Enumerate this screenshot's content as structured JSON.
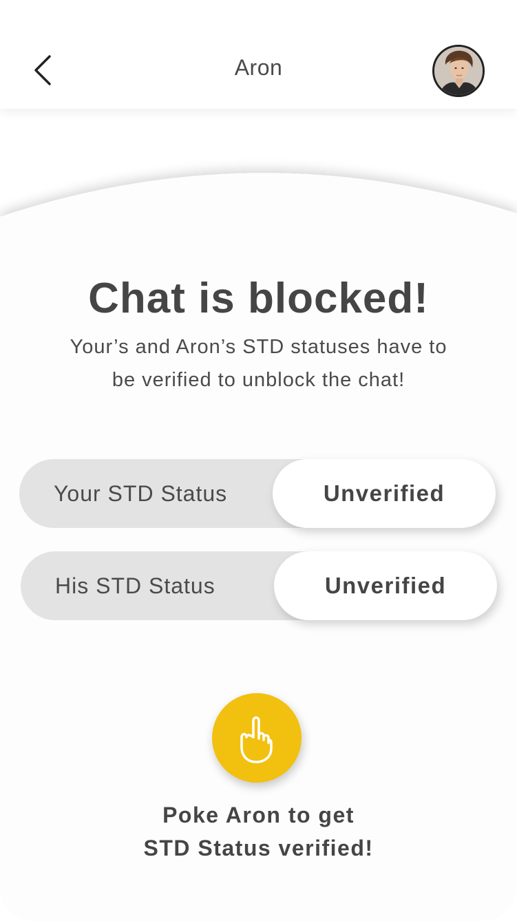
{
  "header": {
    "title": "Aron",
    "back_icon": "chevron-left-icon",
    "avatar_alt": "Aron profile photo"
  },
  "blocked": {
    "title": "Chat is blocked!",
    "description_line1": "Your’s and Aron’s STD statuses have to",
    "description_line2": "be verified to unblock the chat!"
  },
  "statuses": [
    {
      "label": "Your STD Status",
      "value": "Unverified"
    },
    {
      "label": "His STD Status",
      "value": "Unverified"
    }
  ],
  "poke": {
    "icon": "pointing-hand-icon",
    "line1": "Poke Aron to get",
    "line2": "STD Status verified!"
  },
  "colors": {
    "accent": "#f2c00f",
    "text": "#454545",
    "status_track": "#e3e3e3",
    "background": "#ffffff"
  }
}
